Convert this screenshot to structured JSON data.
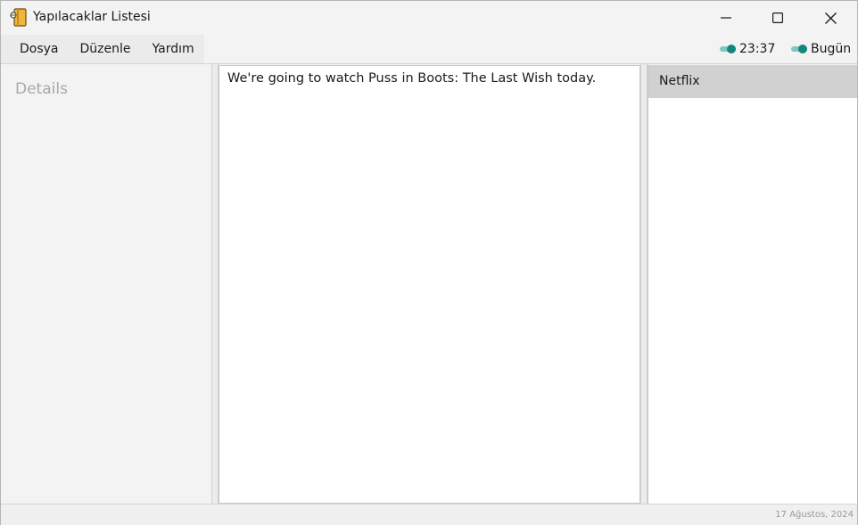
{
  "window": {
    "title": "Yapılacaklar Listesi"
  },
  "menu": {
    "items": [
      {
        "label": "Dosya"
      },
      {
        "label": "Düzenle"
      },
      {
        "label": "Yardım"
      }
    ]
  },
  "toggles": {
    "time": {
      "label": "23:37",
      "on": true
    },
    "today": {
      "label": "Bugün",
      "on": true
    }
  },
  "details": {
    "title": "Details"
  },
  "editor": {
    "text": "We're going to watch Puss in Boots: The Last Wish today."
  },
  "list": {
    "items": [
      {
        "label": "Netflix",
        "selected": true
      }
    ]
  },
  "status": {
    "date": "17 Ağustos, 2024"
  },
  "colors": {
    "accent": "#14857a",
    "accent_track": "#7fc8c0",
    "selected_row": "#d1d1d1"
  }
}
